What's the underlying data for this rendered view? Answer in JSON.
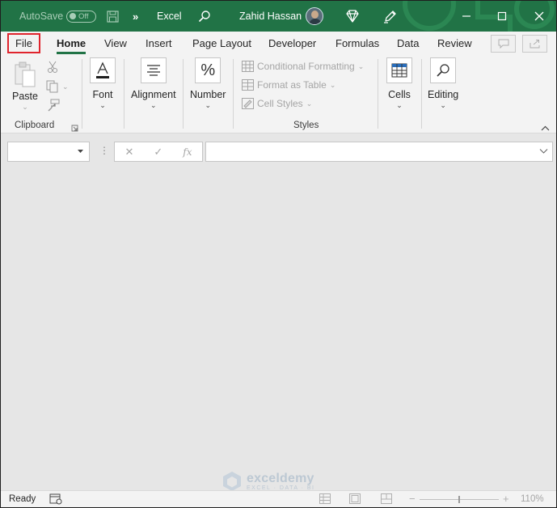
{
  "titlebar": {
    "autosave_label": "AutoSave",
    "autosave_state": "Off",
    "app_name": "Excel",
    "user_name": "Zahid Hassan"
  },
  "tabs": [
    {
      "label": "File"
    },
    {
      "label": "Home"
    },
    {
      "label": "View"
    },
    {
      "label": "Insert"
    },
    {
      "label": "Page Layout"
    },
    {
      "label": "Developer"
    },
    {
      "label": "Formulas"
    },
    {
      "label": "Data"
    },
    {
      "label": "Review"
    }
  ],
  "ribbon": {
    "clipboard": {
      "paste_label": "Paste",
      "group_label": "Clipboard"
    },
    "font_label": "Font",
    "alignment_label": "Alignment",
    "number_label": "Number",
    "number_icon_text": "%",
    "styles": {
      "conditional_formatting": "Conditional Formatting",
      "format_as_table": "Format as Table",
      "cell_styles": "Cell Styles",
      "group_label": "Styles"
    },
    "cells_label": "Cells",
    "editing_label": "Editing"
  },
  "formula_bar": {
    "name_box_value": "",
    "formula_value": "",
    "fx_label": "fx"
  },
  "watermark": {
    "name": "exceldemy",
    "tagline": "EXCEL · DATA · BI"
  },
  "status": {
    "ready_text": "Ready",
    "zoom_level": "110%"
  },
  "colors": {
    "excel_green": "#217346",
    "file_highlight": "#e0242d"
  },
  "icons": [
    "save-icon",
    "more-icon",
    "search-icon",
    "diamond-icon",
    "pen-icon",
    "minimize-icon",
    "restore-icon",
    "close-icon",
    "comments-icon",
    "share-icon",
    "paste-icon",
    "cut-icon",
    "copy-icon",
    "format-painter-icon",
    "font-icon",
    "alignment-icon",
    "number-icon",
    "cells-icon",
    "editing-icon"
  ]
}
